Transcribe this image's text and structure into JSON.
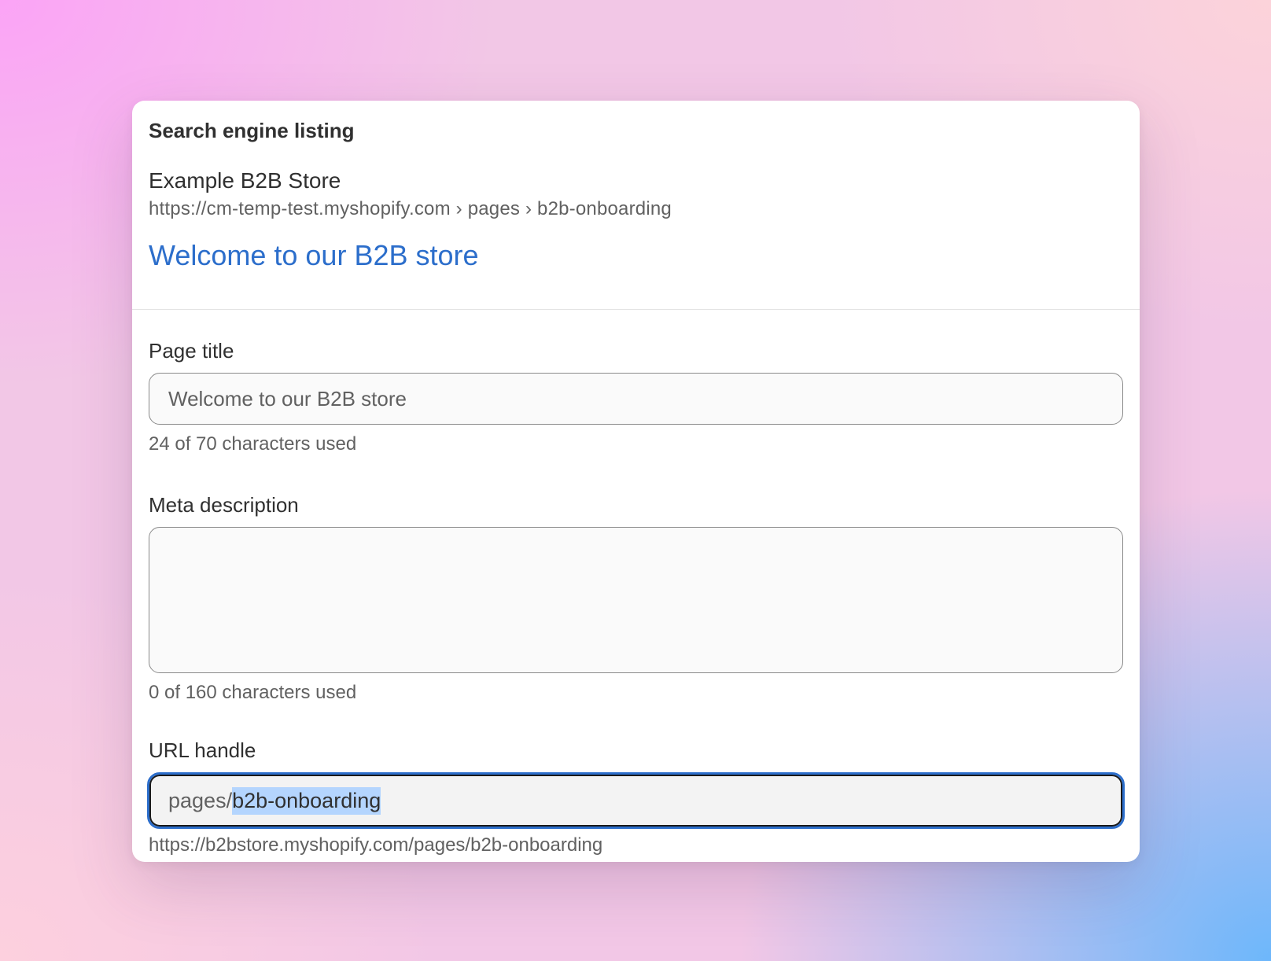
{
  "card": {
    "heading": "Search engine listing"
  },
  "preview": {
    "store_name": "Example B2B Store",
    "breadcrumb": "https://cm-temp-test.myshopify.com › pages › b2b-onboarding",
    "title": "Welcome to our B2B store"
  },
  "page_title_field": {
    "label": "Page title",
    "value": "Welcome to our B2B store",
    "help": "24 of 70 characters used"
  },
  "meta_description_field": {
    "label": "Meta description",
    "value": "",
    "help": "0 of 160 characters used"
  },
  "url_handle_field": {
    "label": "URL handle",
    "prefix": "pages/",
    "value": "b2b-onboarding",
    "help": "https://b2bstore.myshopify.com/pages/b2b-onboarding",
    "focused": true,
    "value_selected": true
  },
  "colors": {
    "link_blue": "#2c6ecb",
    "selection": "#b4d5fe",
    "focus_ring": "#2c6ecb"
  }
}
